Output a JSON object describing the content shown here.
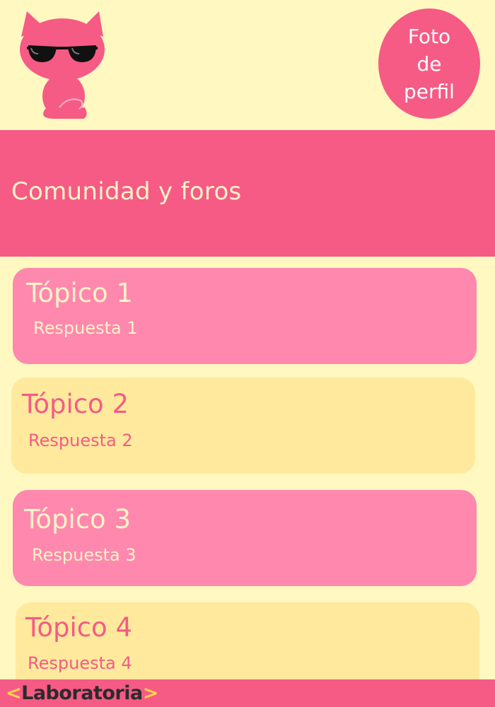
{
  "header": {
    "logo_icon": "cat-with-sunglasses-icon",
    "profile_photo_label": "Foto\nde\nperfil"
  },
  "page": {
    "title": "Comunidad y foros"
  },
  "topics": [
    {
      "title": "Tópico 1",
      "reply": "Respuesta 1",
      "style": "pink"
    },
    {
      "title": "Tópico 2",
      "reply": "Respuesta 2",
      "style": "yellow"
    },
    {
      "title": "Tópico 3",
      "reply": "Respuesta 3",
      "style": "pink"
    },
    {
      "title": "Tópico 4",
      "reply": "Respuesta 4",
      "style": "yellow"
    }
  ],
  "footer": {
    "brand_open": "<",
    "brand_name": "Laboratoria",
    "brand_close": ">"
  },
  "colors": {
    "background": "#fff8c0",
    "primary_pink": "#f55b85",
    "card_pink": "#ff88ae",
    "card_yellow": "#ffe99d",
    "text_cream": "#fff3c8",
    "accent_yellow": "#ffd24d"
  }
}
